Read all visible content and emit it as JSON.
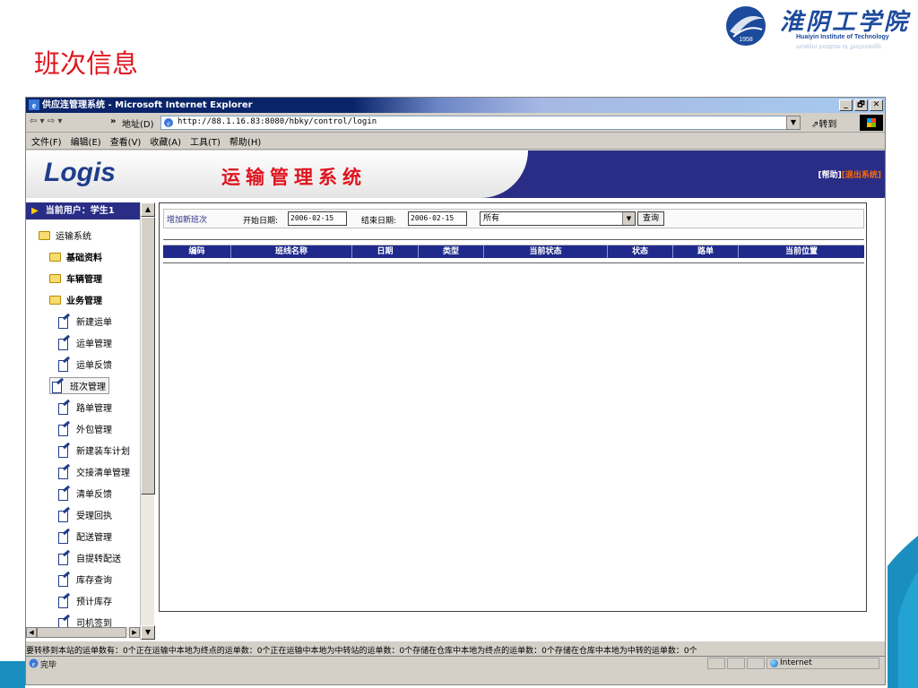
{
  "slide": {
    "title": "班次信息",
    "logo": {
      "cn": "淮阴工学院",
      "en": "Huaiyin Institute of Technology",
      "year": "1958"
    }
  },
  "browser": {
    "window_title": "供应连管理系统 - Microsoft Internet Explorer",
    "window_buttons": [
      "_",
      "🗗",
      "✕"
    ],
    "nav": {
      "arrows": "⇦ ▾ ⇨ ▾",
      "chevron": "»",
      "address_label": "地址(D)",
      "url": "http://88.1.16.83:8080/hbky/control/login",
      "go_label": "转到"
    },
    "menu": [
      "文件(F)",
      "编辑(E)",
      "查看(V)",
      "收藏(A)",
      "工具(T)",
      "帮助(H)"
    ],
    "status": {
      "info": "要转移到本站的运单数有：0个正在运输中本地为终点的运单数：0个正在运输中本地为中转站的运单数：0个存储在仓库中本地为终点的运单数：0个存储在仓库中本地为中转的运单数：0个",
      "done": "完毕",
      "zone": "Internet"
    }
  },
  "app": {
    "banner": {
      "logo": "Logis",
      "system_name": "运输管理系统",
      "help_link": "[帮助]",
      "logout_link": "[退出系统]"
    },
    "user": {
      "label": "当前用户：学生1"
    },
    "tree": {
      "root": "运输系统",
      "folders": [
        "基础资料",
        "车辆管理",
        "业务管理"
      ],
      "items": [
        "新建运单",
        "运单管理",
        "运单反馈",
        "班次管理",
        "路单管理",
        "外包管理",
        "新建装车计划",
        "交接清单管理",
        "清单反馈",
        "受理回执",
        "配送管理",
        "自提转配送",
        "库存查询",
        "预计库存",
        "司机签到"
      ],
      "selected": "班次管理"
    },
    "filter": {
      "add_link": "增加新班次",
      "start_label": "开始日期:",
      "start_value": "2006-02-15",
      "end_label": "结束日期:",
      "end_value": "2006-02-15",
      "status_select": "所有",
      "query_button": "查询"
    },
    "table": {
      "columns": [
        "编码",
        "班线名称",
        "日期",
        "类型",
        "当前状态",
        "状态",
        "路单",
        "当前位置"
      ],
      "rows": []
    }
  },
  "colors": {
    "title_red": "#e0141e",
    "nav_blue": "#2a2d86",
    "header_blue": "#1f2a8c",
    "deco_teal": "#1a8fbf"
  }
}
